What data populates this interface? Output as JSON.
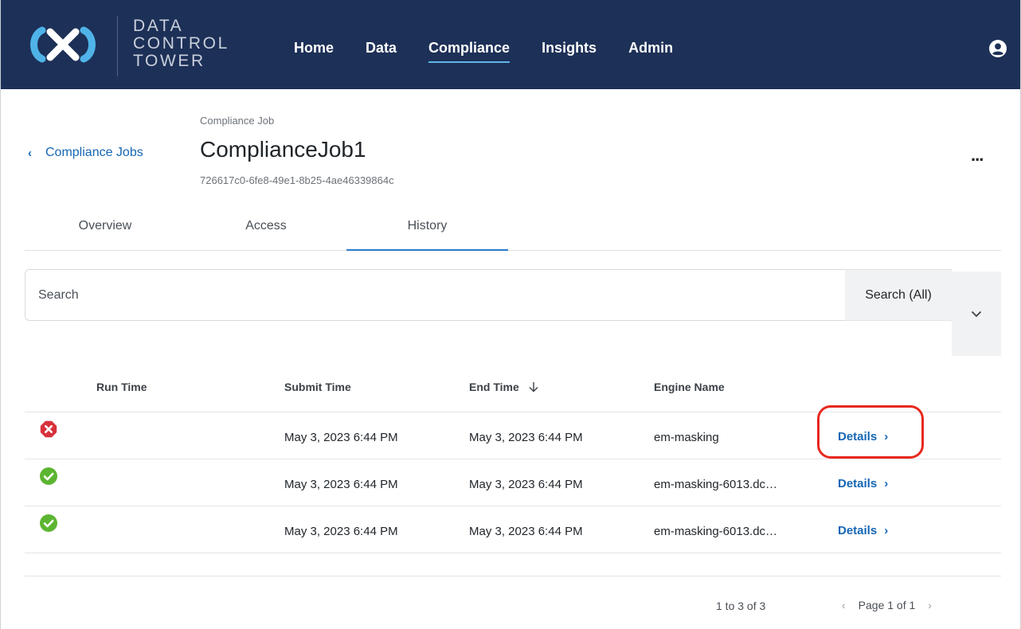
{
  "app": {
    "brand_lines": [
      "DATA",
      "CONTROL",
      "TOWER"
    ],
    "nav": [
      {
        "label": "Home",
        "active": false
      },
      {
        "label": "Data",
        "active": false
      },
      {
        "label": "Compliance",
        "active": true
      },
      {
        "label": "Insights",
        "active": false
      },
      {
        "label": "Admin",
        "active": false
      }
    ],
    "user_icon": "user-circle-icon"
  },
  "header": {
    "back_label": "Compliance Jobs",
    "type_label": "Compliance Job",
    "job_name": "ComplianceJob1",
    "job_id": "726617c0-6fe8-49e1-8b25-4ae46339864c",
    "more_label": "..."
  },
  "tabs": [
    {
      "label": "Overview",
      "active": false
    },
    {
      "label": "Access",
      "active": false
    },
    {
      "label": "History",
      "active": true
    }
  ],
  "search": {
    "placeholder": "Search",
    "value": "",
    "scope_label": "Search (All)"
  },
  "table": {
    "columns": {
      "run_time": "Run Time",
      "submit_time": "Submit Time",
      "end_time": "End Time",
      "engine_name": "Engine Name"
    },
    "end_time_sort": "descending",
    "rows": [
      {
        "status": "failed",
        "status_icon": "error-x-icon",
        "submit_time": "May 3, 2023 6:44 PM",
        "end_time": "May 3, 2023 6:44 PM",
        "engine_name": "em-masking",
        "action": "Details",
        "highlighted": true
      },
      {
        "status": "succeeded",
        "status_icon": "success-check-icon",
        "submit_time": "May 3, 2023 6:44 PM",
        "end_time": "May 3, 2023 6:44 PM",
        "engine_name": "em-masking-6013.dc…",
        "action": "Details",
        "highlighted": false
      },
      {
        "status": "succeeded",
        "status_icon": "success-check-icon",
        "submit_time": "May 3, 2023 6:44 PM",
        "end_time": "May 3, 2023 6:44 PM",
        "engine_name": "em-masking-6013.dc…",
        "action": "Details",
        "highlighted": false
      }
    ]
  },
  "pagination": {
    "range_label": "1 to 3 of 3",
    "page_label": "Page 1 of 1"
  },
  "colors": {
    "nav_background": "#1d3057",
    "link": "#1566b5",
    "tab_active": "#2b7ccc",
    "error": "#d8323c",
    "success": "#5cb531",
    "highlight_ring": "#e8281e"
  }
}
